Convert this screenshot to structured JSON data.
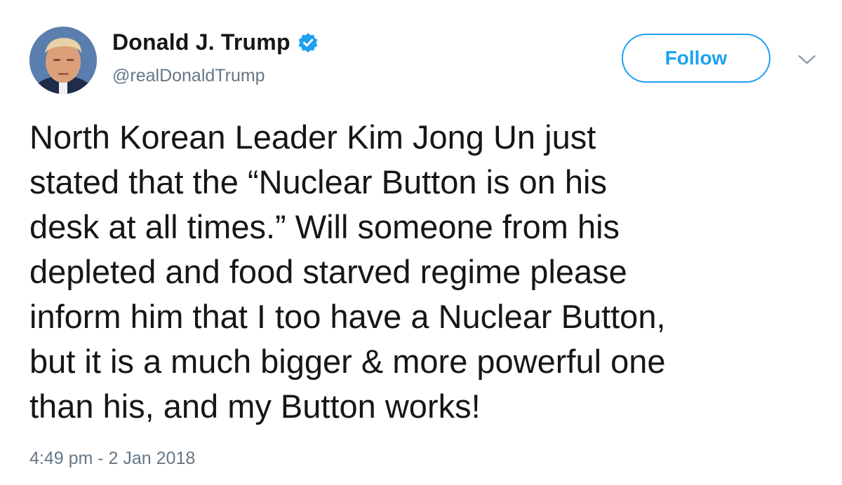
{
  "author": {
    "display_name": "Donald J. Trump",
    "handle": "@realDonaldTrump",
    "verified": true
  },
  "actions": {
    "follow_label": "Follow"
  },
  "tweet": {
    "text": "North Korean Leader Kim Jong Un just\nstated that the “Nuclear Button is on his\ndesk at all times.” Will someone from his\ndepleted and food starved regime please\ninform him that I too have a Nuclear Button,\nbut it is a much bigger & more powerful one\nthan his, and my Button works!",
    "timestamp": "4:49 pm - 2 Jan 2018"
  },
  "icons": {
    "verified": "verified-badge-icon",
    "caret": "chevron-down-icon",
    "avatar": "profile-photo"
  },
  "colors": {
    "accent": "#1da1f2",
    "text": "#14171a",
    "secondary_text": "#657786",
    "background": "#ffffff"
  }
}
